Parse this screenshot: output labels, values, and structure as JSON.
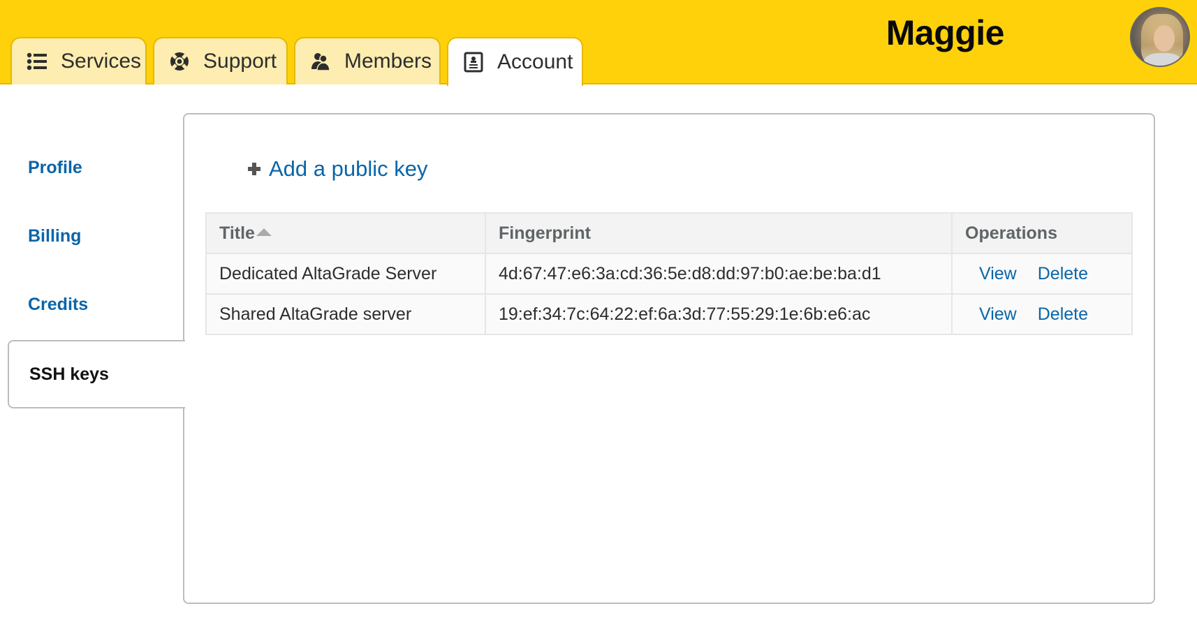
{
  "header": {
    "tabs": [
      {
        "label": "Services",
        "icon": "list-icon",
        "active": false
      },
      {
        "label": "Support",
        "icon": "lifebuoy-icon",
        "active": false
      },
      {
        "label": "Members",
        "icon": "users-icon",
        "active": false
      },
      {
        "label": "Account",
        "icon": "contact-card-icon",
        "active": true
      }
    ],
    "user": {
      "name": "Maggie",
      "avatar": "user-avatar"
    }
  },
  "colors": {
    "brand_yellow": "#ffd10a",
    "tab_inactive": "#fdedb0",
    "link_blue": "#0a65a8"
  },
  "sidebar": {
    "items": [
      {
        "label": "Profile",
        "active": false
      },
      {
        "label": "Billing",
        "active": false
      },
      {
        "label": "Credits",
        "active": false
      },
      {
        "label": "SSH keys",
        "active": true
      }
    ]
  },
  "main": {
    "add_key_label": "Add a public key",
    "table": {
      "columns": [
        "Title",
        "Fingerprint",
        "Operations"
      ],
      "sort": {
        "column": "Title",
        "direction": "ascending"
      },
      "rows": [
        {
          "title": "Dedicated AltaGrade Server",
          "fingerprint": "4d:67:47:e6:3a:cd:36:5e:d8:dd:97:b0:ae:be:ba:d1",
          "view": "View",
          "delete": "Delete"
        },
        {
          "title": "Shared AltaGrade server",
          "fingerprint": "19:ef:34:7c:64:22:ef:6a:3d:77:55:29:1e:6b:e6:ac",
          "view": "View",
          "delete": "Delete"
        }
      ]
    }
  }
}
